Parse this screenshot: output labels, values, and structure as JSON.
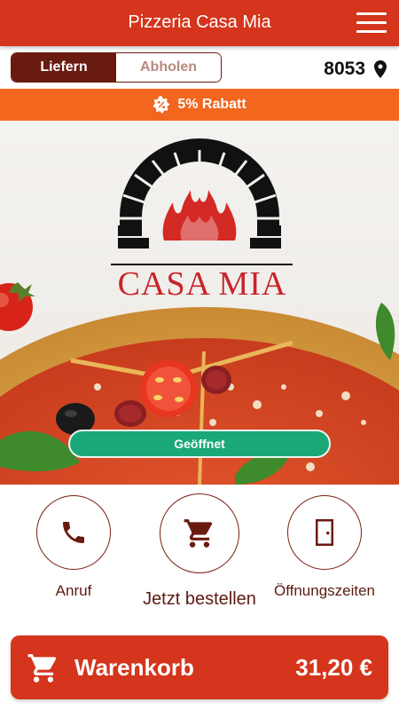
{
  "header": {
    "title": "Pizzeria Casa Mia",
    "menu_icon": "hamburger-menu-icon"
  },
  "mode_toggle": {
    "delivery_label": "Liefern",
    "pickup_label": "Abholen",
    "selected": "Liefern"
  },
  "location": {
    "postcode": "8053",
    "icon": "location-pin-icon"
  },
  "promo": {
    "text": "5% Rabatt",
    "icon": "discount-badge-icon"
  },
  "hero": {
    "logo_text": "CASA MIA",
    "status_label": "Geöffnet"
  },
  "actions": [
    {
      "label": "Anruf",
      "icon": "phone-icon"
    },
    {
      "label": "Jetzt bestellen",
      "icon": "cart-icon"
    },
    {
      "label": "Öffnungszeiten",
      "icon": "door-icon"
    }
  ],
  "cart": {
    "label": "Warenkorb",
    "total": "31,20 €",
    "icon": "cart-icon"
  },
  "colors": {
    "header_red": "#d4351c",
    "toggle_dark": "#6a1b10",
    "promo_orange": "#f2661e",
    "open_green": "#1aa879",
    "accent_brown": "#7a1f12"
  }
}
